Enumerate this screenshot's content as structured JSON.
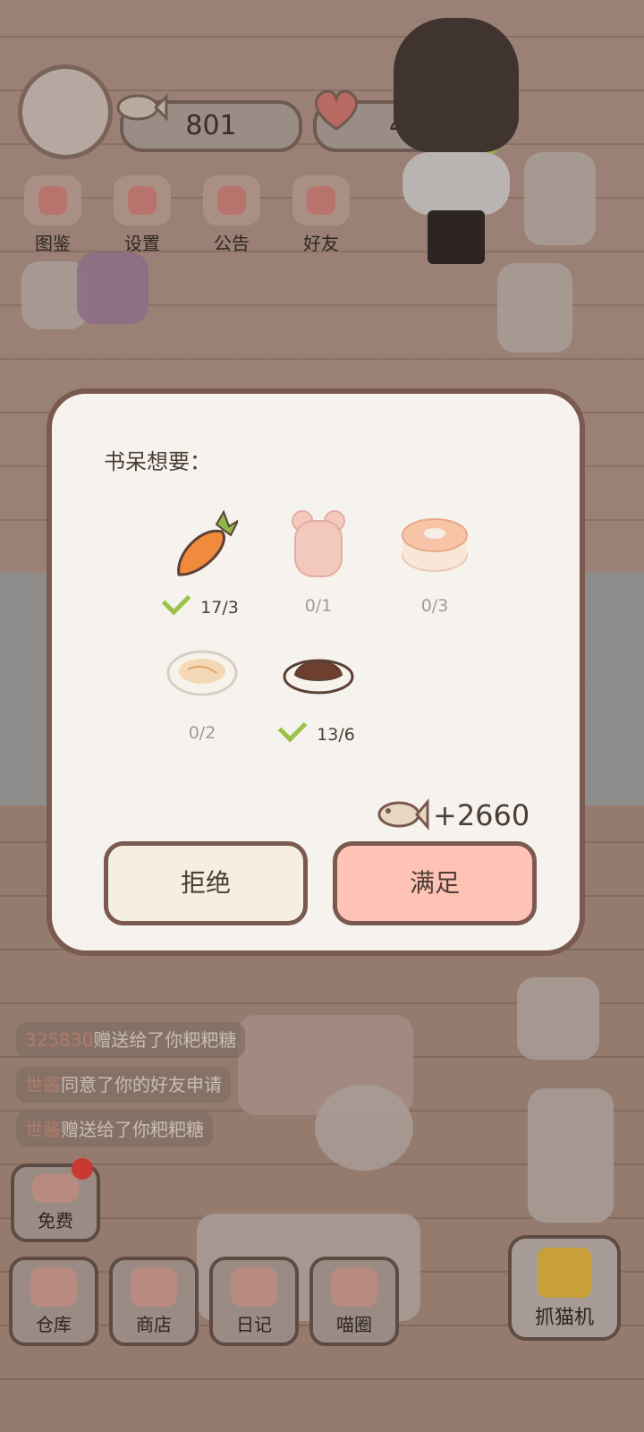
{
  "currencies": {
    "fish": "801",
    "hearts": "41"
  },
  "top_menu": [
    {
      "label": "图鉴",
      "icon": "cat-face-icon"
    },
    {
      "label": "设置",
      "icon": "gear-icon"
    },
    {
      "label": "公告",
      "icon": "gift-icon"
    },
    {
      "label": "好友",
      "icon": "friends-icon"
    }
  ],
  "chat": [
    {
      "name": "325830",
      "text": "赠送给了你粑粑糖"
    },
    {
      "name": "世酱",
      "text": "同意了你的好友申请"
    },
    {
      "name": "世酱",
      "text": "赠送给了你粑粑糖"
    }
  ],
  "free_label": "免费",
  "bottom_nav": [
    {
      "label": "仓库",
      "icon": "warehouse-icon"
    },
    {
      "label": "商店",
      "icon": "shop-icon"
    },
    {
      "label": "日记",
      "icon": "diary-icon"
    },
    {
      "label": "喵圈",
      "icon": "cat-planet-icon"
    }
  ],
  "claw_label": "抓猫机",
  "dialog": {
    "title": "书呆想要：",
    "items": [
      {
        "name": "carrot",
        "count": "17/3",
        "done": true
      },
      {
        "name": "bear-cookie",
        "count": "0/1",
        "done": false
      },
      {
        "name": "cake-roll",
        "count": "0/3",
        "done": false
      },
      {
        "name": "noodle-plate",
        "count": "0/2",
        "done": false
      },
      {
        "name": "curry-plate",
        "count": "13/6",
        "done": true
      }
    ],
    "reward": "+2660",
    "reject_label": "拒绝",
    "accept_label": "满足"
  },
  "colors": {
    "check": "#9cc24a",
    "accept": "#ffc3b6",
    "reject": "#f4efe0",
    "border": "#7a5a50"
  }
}
